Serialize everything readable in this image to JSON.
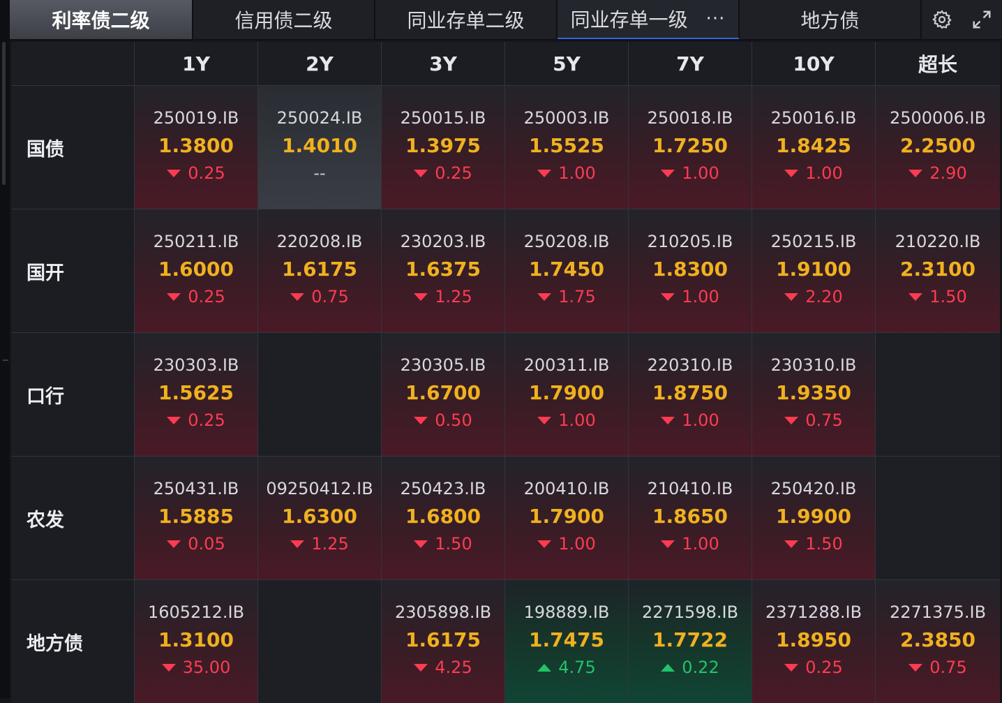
{
  "tabs": [
    {
      "label": "利率债二级"
    },
    {
      "label": "信用债二级"
    },
    {
      "label": "同业存单二级"
    },
    {
      "label": "同业存单一级",
      "more": "···"
    },
    {
      "label": "地方债"
    }
  ],
  "icons": {
    "settings": "gear-icon",
    "expand": "expand-icon"
  },
  "colors": {
    "yield": "#f0b11f",
    "down": "#ff3b52",
    "up": "#22c36a"
  },
  "columns": [
    "1Y",
    "2Y",
    "3Y",
    "5Y",
    "7Y",
    "10Y",
    "超长"
  ],
  "rows": [
    {
      "label": "国债",
      "cells": [
        {
          "code": "250019.IB",
          "yield": "1.3800",
          "change": "0.25",
          "dir": "down"
        },
        {
          "code": "250024.IB",
          "yield": "1.4010",
          "change": "--",
          "dir": "none"
        },
        {
          "code": "250015.IB",
          "yield": "1.3975",
          "change": "0.25",
          "dir": "down"
        },
        {
          "code": "250003.IB",
          "yield": "1.5525",
          "change": "1.00",
          "dir": "down"
        },
        {
          "code": "250018.IB",
          "yield": "1.7250",
          "change": "1.00",
          "dir": "down"
        },
        {
          "code": "250016.IB",
          "yield": "1.8425",
          "change": "1.00",
          "dir": "down"
        },
        {
          "code": "2500006.IB",
          "yield": "2.2500",
          "change": "2.90",
          "dir": "down"
        }
      ]
    },
    {
      "label": "国开",
      "cells": [
        {
          "code": "250211.IB",
          "yield": "1.6000",
          "change": "0.25",
          "dir": "down"
        },
        {
          "code": "220208.IB",
          "yield": "1.6175",
          "change": "0.75",
          "dir": "down"
        },
        {
          "code": "230203.IB",
          "yield": "1.6375",
          "change": "1.25",
          "dir": "down"
        },
        {
          "code": "250208.IB",
          "yield": "1.7450",
          "change": "1.75",
          "dir": "down"
        },
        {
          "code": "210205.IB",
          "yield": "1.8300",
          "change": "1.00",
          "dir": "down"
        },
        {
          "code": "250215.IB",
          "yield": "1.9100",
          "change": "2.20",
          "dir": "down"
        },
        {
          "code": "210220.IB",
          "yield": "2.3100",
          "change": "1.50",
          "dir": "down"
        }
      ]
    },
    {
      "label": "口行",
      "cells": [
        {
          "code": "230303.IB",
          "yield": "1.5625",
          "change": "0.25",
          "dir": "down"
        },
        null,
        {
          "code": "230305.IB",
          "yield": "1.6700",
          "change": "0.50",
          "dir": "down"
        },
        {
          "code": "200311.IB",
          "yield": "1.7900",
          "change": "1.00",
          "dir": "down"
        },
        {
          "code": "220310.IB",
          "yield": "1.8750",
          "change": "1.00",
          "dir": "down"
        },
        {
          "code": "230310.IB",
          "yield": "1.9350",
          "change": "0.75",
          "dir": "down"
        },
        null
      ]
    },
    {
      "label": "农发",
      "cells": [
        {
          "code": "250431.IB",
          "yield": "1.5885",
          "change": "0.05",
          "dir": "down"
        },
        {
          "code": "09250412.IB",
          "yield": "1.6300",
          "change": "1.25",
          "dir": "down"
        },
        {
          "code": "250423.IB",
          "yield": "1.6800",
          "change": "1.50",
          "dir": "down"
        },
        {
          "code": "200410.IB",
          "yield": "1.7900",
          "change": "1.00",
          "dir": "down"
        },
        {
          "code": "210410.IB",
          "yield": "1.8650",
          "change": "1.00",
          "dir": "down"
        },
        {
          "code": "250420.IB",
          "yield": "1.9900",
          "change": "1.50",
          "dir": "down"
        },
        null
      ]
    },
    {
      "label": "地方债",
      "cells": [
        {
          "code": "1605212.IB",
          "yield": "1.3100",
          "change": "35.00",
          "dir": "down"
        },
        null,
        {
          "code": "2305898.IB",
          "yield": "1.6175",
          "change": "4.25",
          "dir": "down"
        },
        {
          "code": "198889.IB",
          "yield": "1.7475",
          "change": "4.75",
          "dir": "up"
        },
        {
          "code": "2271598.IB",
          "yield": "1.7722",
          "change": "0.22",
          "dir": "up"
        },
        {
          "code": "2371288.IB",
          "yield": "1.8950",
          "change": "0.25",
          "dir": "down"
        },
        {
          "code": "2271375.IB",
          "yield": "2.3850",
          "change": "0.75",
          "dir": "down"
        }
      ]
    }
  ]
}
